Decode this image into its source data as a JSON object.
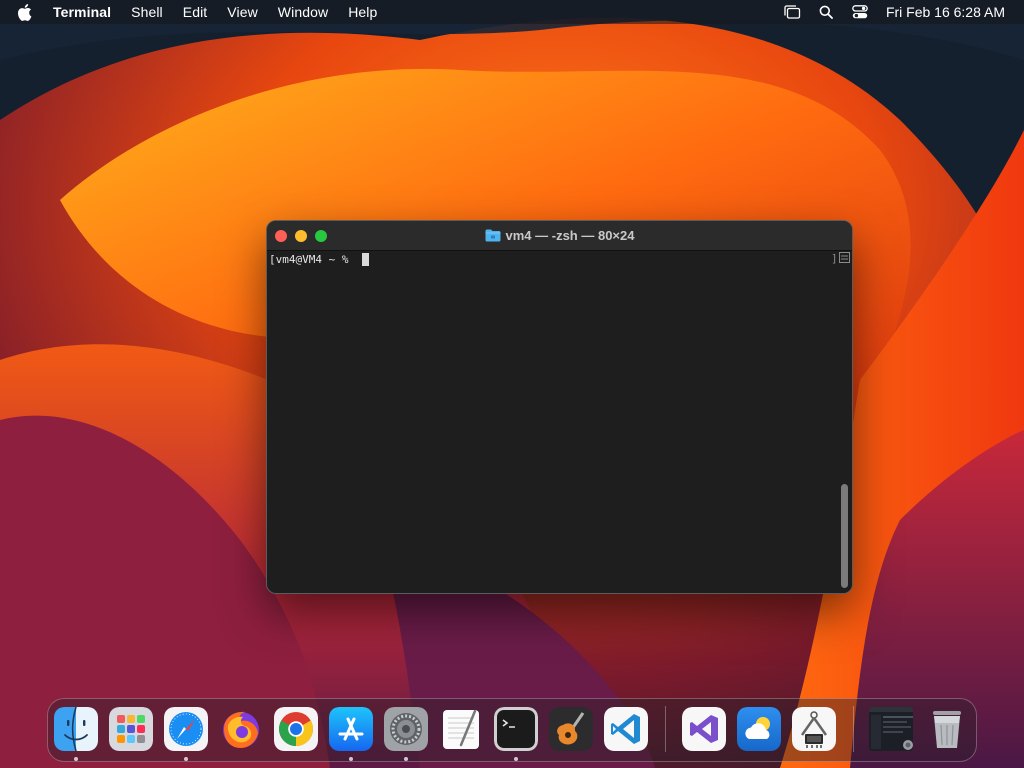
{
  "menubar": {
    "apple_icon": "apple-logo-icon",
    "app_name": "Terminal",
    "menus": [
      "Shell",
      "Edit",
      "View",
      "Window",
      "Help"
    ],
    "status_icons": [
      "stage-manager-icon",
      "spotlight-search-icon",
      "control-center-icon"
    ],
    "clock": "Fri Feb 16  6:28 AM"
  },
  "terminal": {
    "title": "vm4 — -zsh — 80×24",
    "title_icon": "folder-icon",
    "prompt": "[vm4@VM4 ~ % ",
    "colors": {
      "background": "#1e1e1e",
      "titlebar": "#2b2b2b",
      "text": "#e8e8e8"
    }
  },
  "dock": {
    "apps": [
      {
        "name": "Finder",
        "icon": "finder-icon",
        "running": true
      },
      {
        "name": "Launchpad",
        "icon": "launchpad-icon",
        "running": false
      },
      {
        "name": "Safari",
        "icon": "safari-icon",
        "running": true
      },
      {
        "name": "Firefox",
        "icon": "firefox-icon",
        "running": false
      },
      {
        "name": "Google Chrome",
        "icon": "chrome-icon",
        "running": false
      },
      {
        "name": "App Store",
        "icon": "app-store-icon",
        "running": true
      },
      {
        "name": "System Settings",
        "icon": "system-settings-icon",
        "running": true
      },
      {
        "name": "TextEdit",
        "icon": "textedit-icon",
        "running": false
      },
      {
        "name": "Terminal",
        "icon": "terminal-icon",
        "running": true
      },
      {
        "name": "GarageBand",
        "icon": "garageband-icon",
        "running": false
      },
      {
        "name": "Visual Studio Code",
        "icon": "vscode-icon",
        "running": false
      },
      {
        "name": "Visual Studio",
        "icon": "visual-studio-icon",
        "running": false
      },
      {
        "name": "Weather",
        "icon": "weather-icon",
        "running": false
      },
      {
        "name": "System Information",
        "icon": "system-information-icon",
        "running": false
      },
      {
        "name": "Recent Window",
        "icon": "minimized-window-icon",
        "running": false
      },
      {
        "name": "Trash",
        "icon": "trash-icon",
        "running": false
      }
    ]
  }
}
